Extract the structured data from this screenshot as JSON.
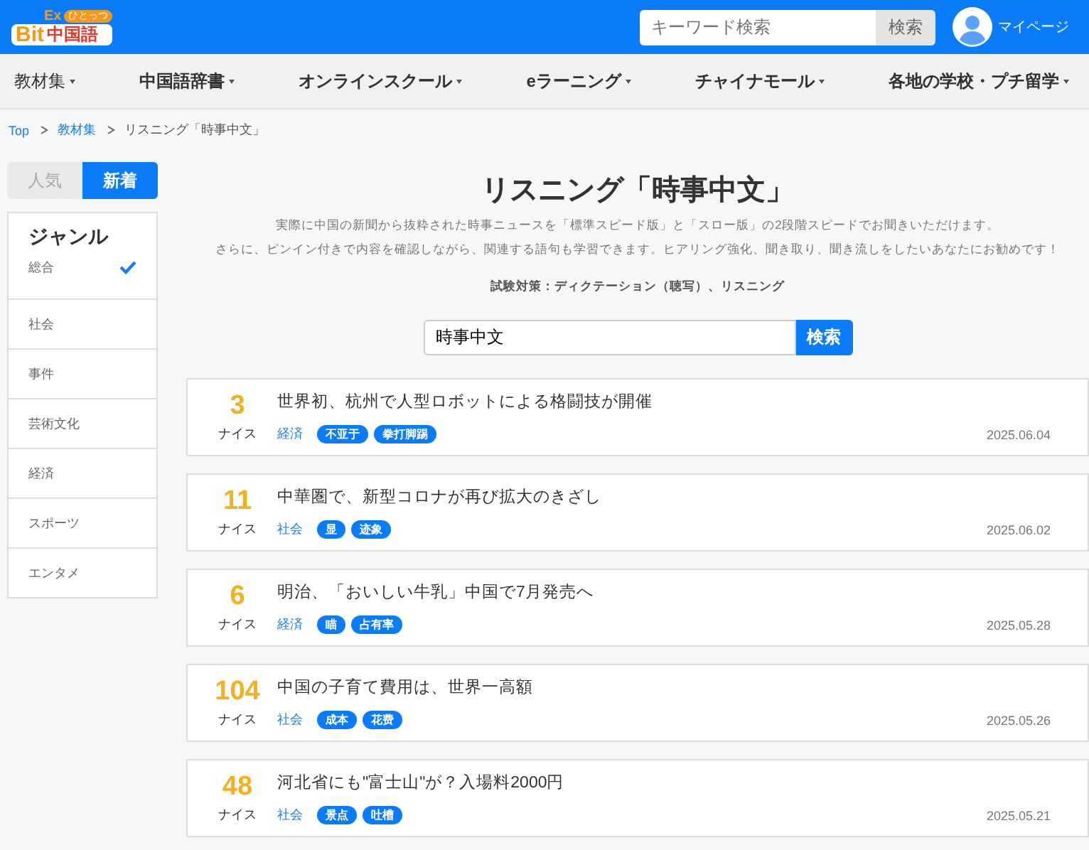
{
  "header": {
    "logo": {
      "main": "Bit",
      "ex": "Ex",
      "bubble": "ひとっつ",
      "sub": "中国語"
    },
    "search": {
      "placeholder": "キーワード検索",
      "button": "検索"
    },
    "account": "マイページ"
  },
  "nav": [
    {
      "label": "教材集"
    },
    {
      "label": "中国語辞書"
    },
    {
      "label": "オンラインスクール"
    },
    {
      "label": "eラーニング"
    },
    {
      "label": "チャイナモール"
    },
    {
      "label": "各地の学校・プチ留学"
    }
  ],
  "breadcrumb": [
    {
      "label": "Top",
      "link": true
    },
    {
      "label": "教材集",
      "link": true
    },
    {
      "label": "リスニング「時事中文」",
      "link": false
    }
  ],
  "sort_tabs": [
    {
      "label": "人気",
      "selected": false
    },
    {
      "label": "新着",
      "selected": true
    }
  ],
  "genre": {
    "title": "ジャンル",
    "items": [
      {
        "label": "総合",
        "selected": true
      },
      {
        "label": "社会",
        "selected": false
      },
      {
        "label": "事件",
        "selected": false
      },
      {
        "label": "芸術文化",
        "selected": false
      },
      {
        "label": "経済",
        "selected": false
      },
      {
        "label": "スポーツ",
        "selected": false
      },
      {
        "label": "エンタメ",
        "selected": false
      }
    ]
  },
  "title": "リスニング「時事中文」",
  "description": [
    "実際に中国の新聞から抜粋された時事ニュースを「標準スピード版」と「スロー版」の2段階スピードでお聞きいただけます。",
    "さらに、ピンイン付きで内容を確認しながら、関連する語句も学習できます。ヒアリング強化、聞き取り、聞き流しをしたいあなたにお勧めです！"
  ],
  "exam": "試験対策：ディクテーション（聴写）、リスニング",
  "search": {
    "value": "時事中文",
    "button": "検索"
  },
  "articles": [
    {
      "count": "3",
      "count_label": "ナイス",
      "title": "世界初、杭州で人型ロボットによる格闘技が開催",
      "category": "経済",
      "tags": [
        "不亚于",
        "拳打脚踢"
      ],
      "date": "2025.06.04"
    },
    {
      "count": "11",
      "count_label": "ナイス",
      "title": "中華圏で、新型コロナが再び拡大のきざし",
      "category": "社会",
      "tags": [
        "显",
        "迹象"
      ],
      "date": "2025.06.02"
    },
    {
      "count": "6",
      "count_label": "ナイス",
      "title": "明治、「おいしい牛乳」中国で7月発売へ",
      "category": "経済",
      "tags": [
        "瞄",
        "占有率"
      ],
      "date": "2025.05.28"
    },
    {
      "count": "104",
      "count_label": "ナイス",
      "title": "中国の子育て費用は、世界一高額",
      "category": "社会",
      "tags": [
        "成本",
        "花费"
      ],
      "date": "2025.05.26"
    },
    {
      "count": "48",
      "count_label": "ナイス",
      "title": "河北省にも\"富士山\"が？入場料2000円",
      "category": "社会",
      "tags": [
        "景点",
        "吐槽"
      ],
      "date": "2025.05.21"
    }
  ]
}
